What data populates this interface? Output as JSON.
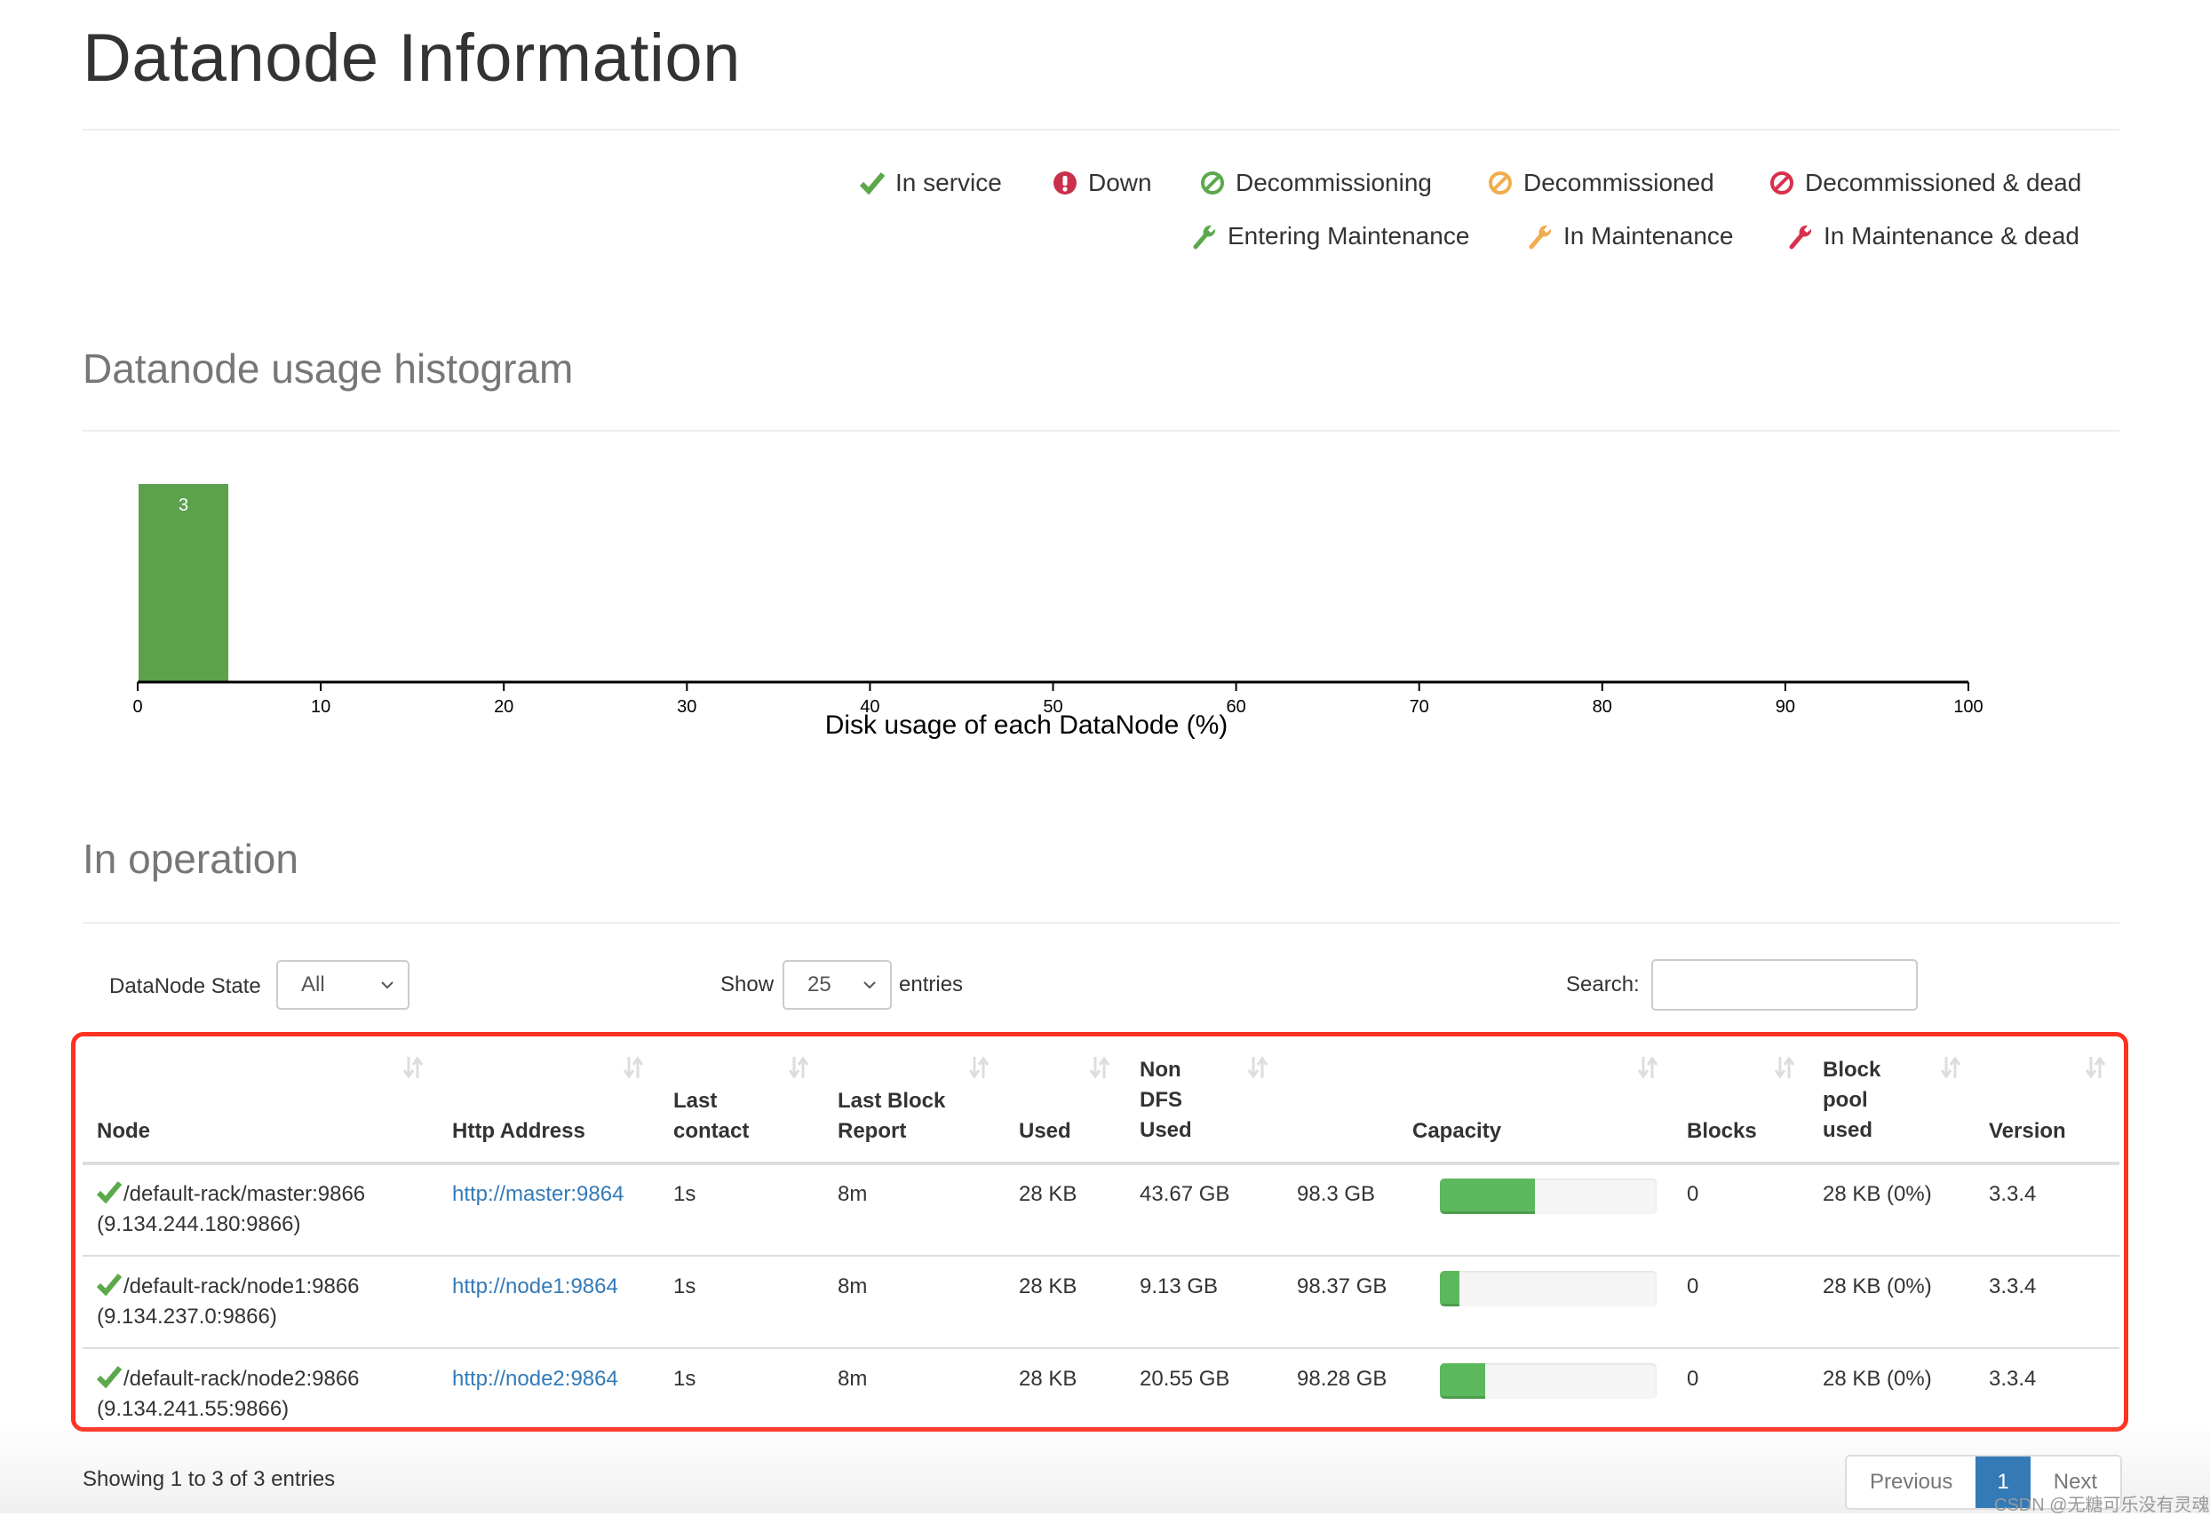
{
  "page": {
    "title": "Datanode Information"
  },
  "legend": [
    {
      "label": "In service",
      "icon": "check-icon",
      "color": "#5ca94c"
    },
    {
      "label": "Down",
      "icon": "exclamation-circle-icon",
      "color": "#c9302c"
    },
    {
      "label": "Decommissioning",
      "icon": "ban-icon",
      "color": "#5ca94c"
    },
    {
      "label": "Decommissioned",
      "icon": "ban-icon",
      "color": "#f0ad4e"
    },
    {
      "label": "Decommissioned & dead",
      "icon": "ban-icon",
      "color": "#d9304c"
    },
    {
      "label": "Entering Maintenance",
      "icon": "wrench-icon",
      "color": "#5ca94c"
    },
    {
      "label": "In Maintenance",
      "icon": "wrench-icon",
      "color": "#f0ad4e"
    },
    {
      "label": "In Maintenance & dead",
      "icon": "wrench-icon",
      "color": "#d9304c"
    }
  ],
  "histogram": {
    "heading": "Datanode usage histogram"
  },
  "chart_data": {
    "type": "bar",
    "title": "Datanode usage histogram",
    "xlabel": "Disk usage of each DataNode (%)",
    "ylabel": "",
    "xlim": [
      0,
      100
    ],
    "x_ticks": [
      "0",
      "10",
      "20",
      "30",
      "40",
      "50",
      "60",
      "70",
      "80",
      "90",
      "100"
    ],
    "bins": [
      {
        "range": [
          0,
          5
        ],
        "count": 3
      }
    ],
    "data_labels": [
      "3"
    ],
    "bar_color": "#5ca14c",
    "grid": false
  },
  "operation": {
    "heading": "In operation",
    "state_label": "DataNode State",
    "state_value": "All",
    "show_label": "Show",
    "show_value": "25",
    "entries_label": "entries",
    "search_label": "Search:",
    "search_value": "",
    "columns": [
      {
        "lines": [
          "Node"
        ]
      },
      {
        "lines": [
          "Http Address"
        ]
      },
      {
        "lines": [
          "Last",
          "contact"
        ]
      },
      {
        "lines": [
          "Last Block",
          "Report"
        ]
      },
      {
        "lines": [
          "Used"
        ]
      },
      {
        "lines": [
          "Non",
          "DFS",
          "Used"
        ]
      },
      {
        "lines": [
          "Capacity"
        ]
      },
      {
        "lines": [
          "Blocks"
        ]
      },
      {
        "lines": [
          "Block",
          "pool",
          "used"
        ]
      },
      {
        "lines": [
          "Version"
        ]
      }
    ],
    "rows": [
      {
        "node": "/default-rack/master:9866",
        "ip": "(9.134.244.180:9866)",
        "http": "http://master:9864",
        "last_contact": "1s",
        "last_block_report": "8m",
        "used": "28 KB",
        "non_dfs_used": "43.67 GB",
        "capacity": "98.3 GB",
        "capacity_used_pct": 44,
        "blocks": "0",
        "block_pool_used": "28 KB (0%)",
        "version": "3.3.4",
        "status": "in-service"
      },
      {
        "node": "/default-rack/node1:9866",
        "ip": "(9.134.237.0:9866)",
        "http": "http://node1:9864",
        "last_contact": "1s",
        "last_block_report": "8m",
        "used": "28 KB",
        "non_dfs_used": "9.13 GB",
        "capacity": "98.37 GB",
        "capacity_used_pct": 9,
        "blocks": "0",
        "block_pool_used": "28 KB (0%)",
        "version": "3.3.4",
        "status": "in-service"
      },
      {
        "node": "/default-rack/node2:9866",
        "ip": "(9.134.241.55:9866)",
        "http": "http://node2:9864",
        "last_contact": "1s",
        "last_block_report": "8m",
        "used": "28 KB",
        "non_dfs_used": "20.55 GB",
        "capacity": "98.28 GB",
        "capacity_used_pct": 21,
        "blocks": "0",
        "block_pool_used": "28 KB (0%)",
        "version": "3.3.4",
        "status": "in-service"
      }
    ],
    "info": "Showing 1 to 3 of 3 entries",
    "pagination": {
      "previous": "Previous",
      "current": "1",
      "next": "Next"
    }
  },
  "watermark": "CSDN @无糖可乐没有灵魂",
  "colors": {
    "highlight_frame": "#ff3120",
    "link": "#337ab7",
    "progress": "#5cb85c",
    "active_page": "#337ab7"
  }
}
